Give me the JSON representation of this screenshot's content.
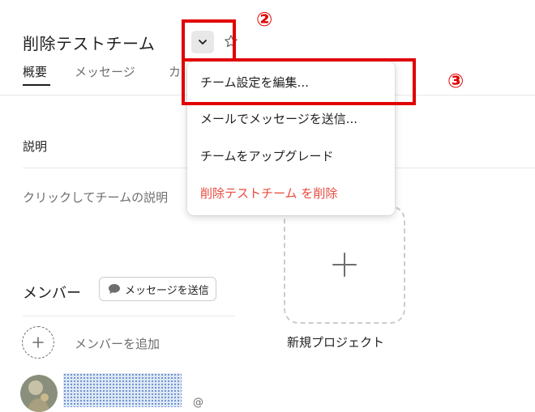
{
  "header": {
    "team_title": "削除テストチーム",
    "tabs": [
      {
        "label": "概要",
        "active": true
      },
      {
        "label": "メッセージ",
        "active": false
      },
      {
        "label": "カ",
        "active": false
      }
    ]
  },
  "description": {
    "heading": "説明",
    "placeholder": "クリックしてチームの説明"
  },
  "members": {
    "heading": "メンバー",
    "send_message_label": "メッセージを送信",
    "add_member_label": "メンバーを追加",
    "extra_glyph": "@"
  },
  "projects": {
    "new_project_label": "新規プロジェクト"
  },
  "dropdown": {
    "items": [
      {
        "label": "チーム設定を編集...",
        "danger": false
      },
      {
        "label": "メールでメッセージを送信...",
        "danger": false
      },
      {
        "label": "チームをアップグレード",
        "danger": false
      },
      {
        "label": "削除テストチーム を削除",
        "danger": true
      }
    ]
  },
  "annotations": {
    "step_dropdown": "②",
    "step_edit": "③",
    "color": "#e10000"
  },
  "colors": {
    "danger": "#e8493d",
    "text_primary": "#1e1f21",
    "text_secondary": "#6d6e6f"
  }
}
